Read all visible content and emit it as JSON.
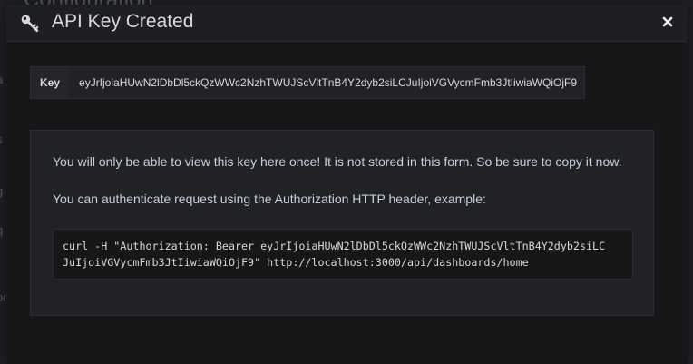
{
  "background": {
    "page_title": "Configuration",
    "fragments": [
      "a",
      "s",
      "g",
      "q",
      "or"
    ]
  },
  "modal": {
    "title": "API Key Created",
    "icon": "key-icon",
    "close_icon": "close-icon",
    "key_label": "Key",
    "key_value": "eyJrIjoiaHUwN2lDbDl5ckQzWWc2NzhTWUJScVltTnB4Y2dyb2siLCJuIjoiVGVycmFmb3JtIiwiaWQiOjF9",
    "info_line_1": "You will only be able to view this key here once! It is not stored in this form. So be sure to copy it now.",
    "info_line_2": "You can authenticate request using the Authorization HTTP header, example:",
    "code_line_1": "curl -H \"Authorization: Bearer eyJrIjoiaHUwN2lDbDl5ckQzWWc2NzhTWUJScVltTnB4Y2dyb2siLC",
    "code_line_2": "JuIjoiVGVycmFmb3JtIiwiaWQiOjF9\" http://localhost:3000/api/dashboards/home"
  },
  "colors": {
    "modal_bg": "#161719",
    "panel_bg": "#202226",
    "text": "#d8d9da"
  }
}
